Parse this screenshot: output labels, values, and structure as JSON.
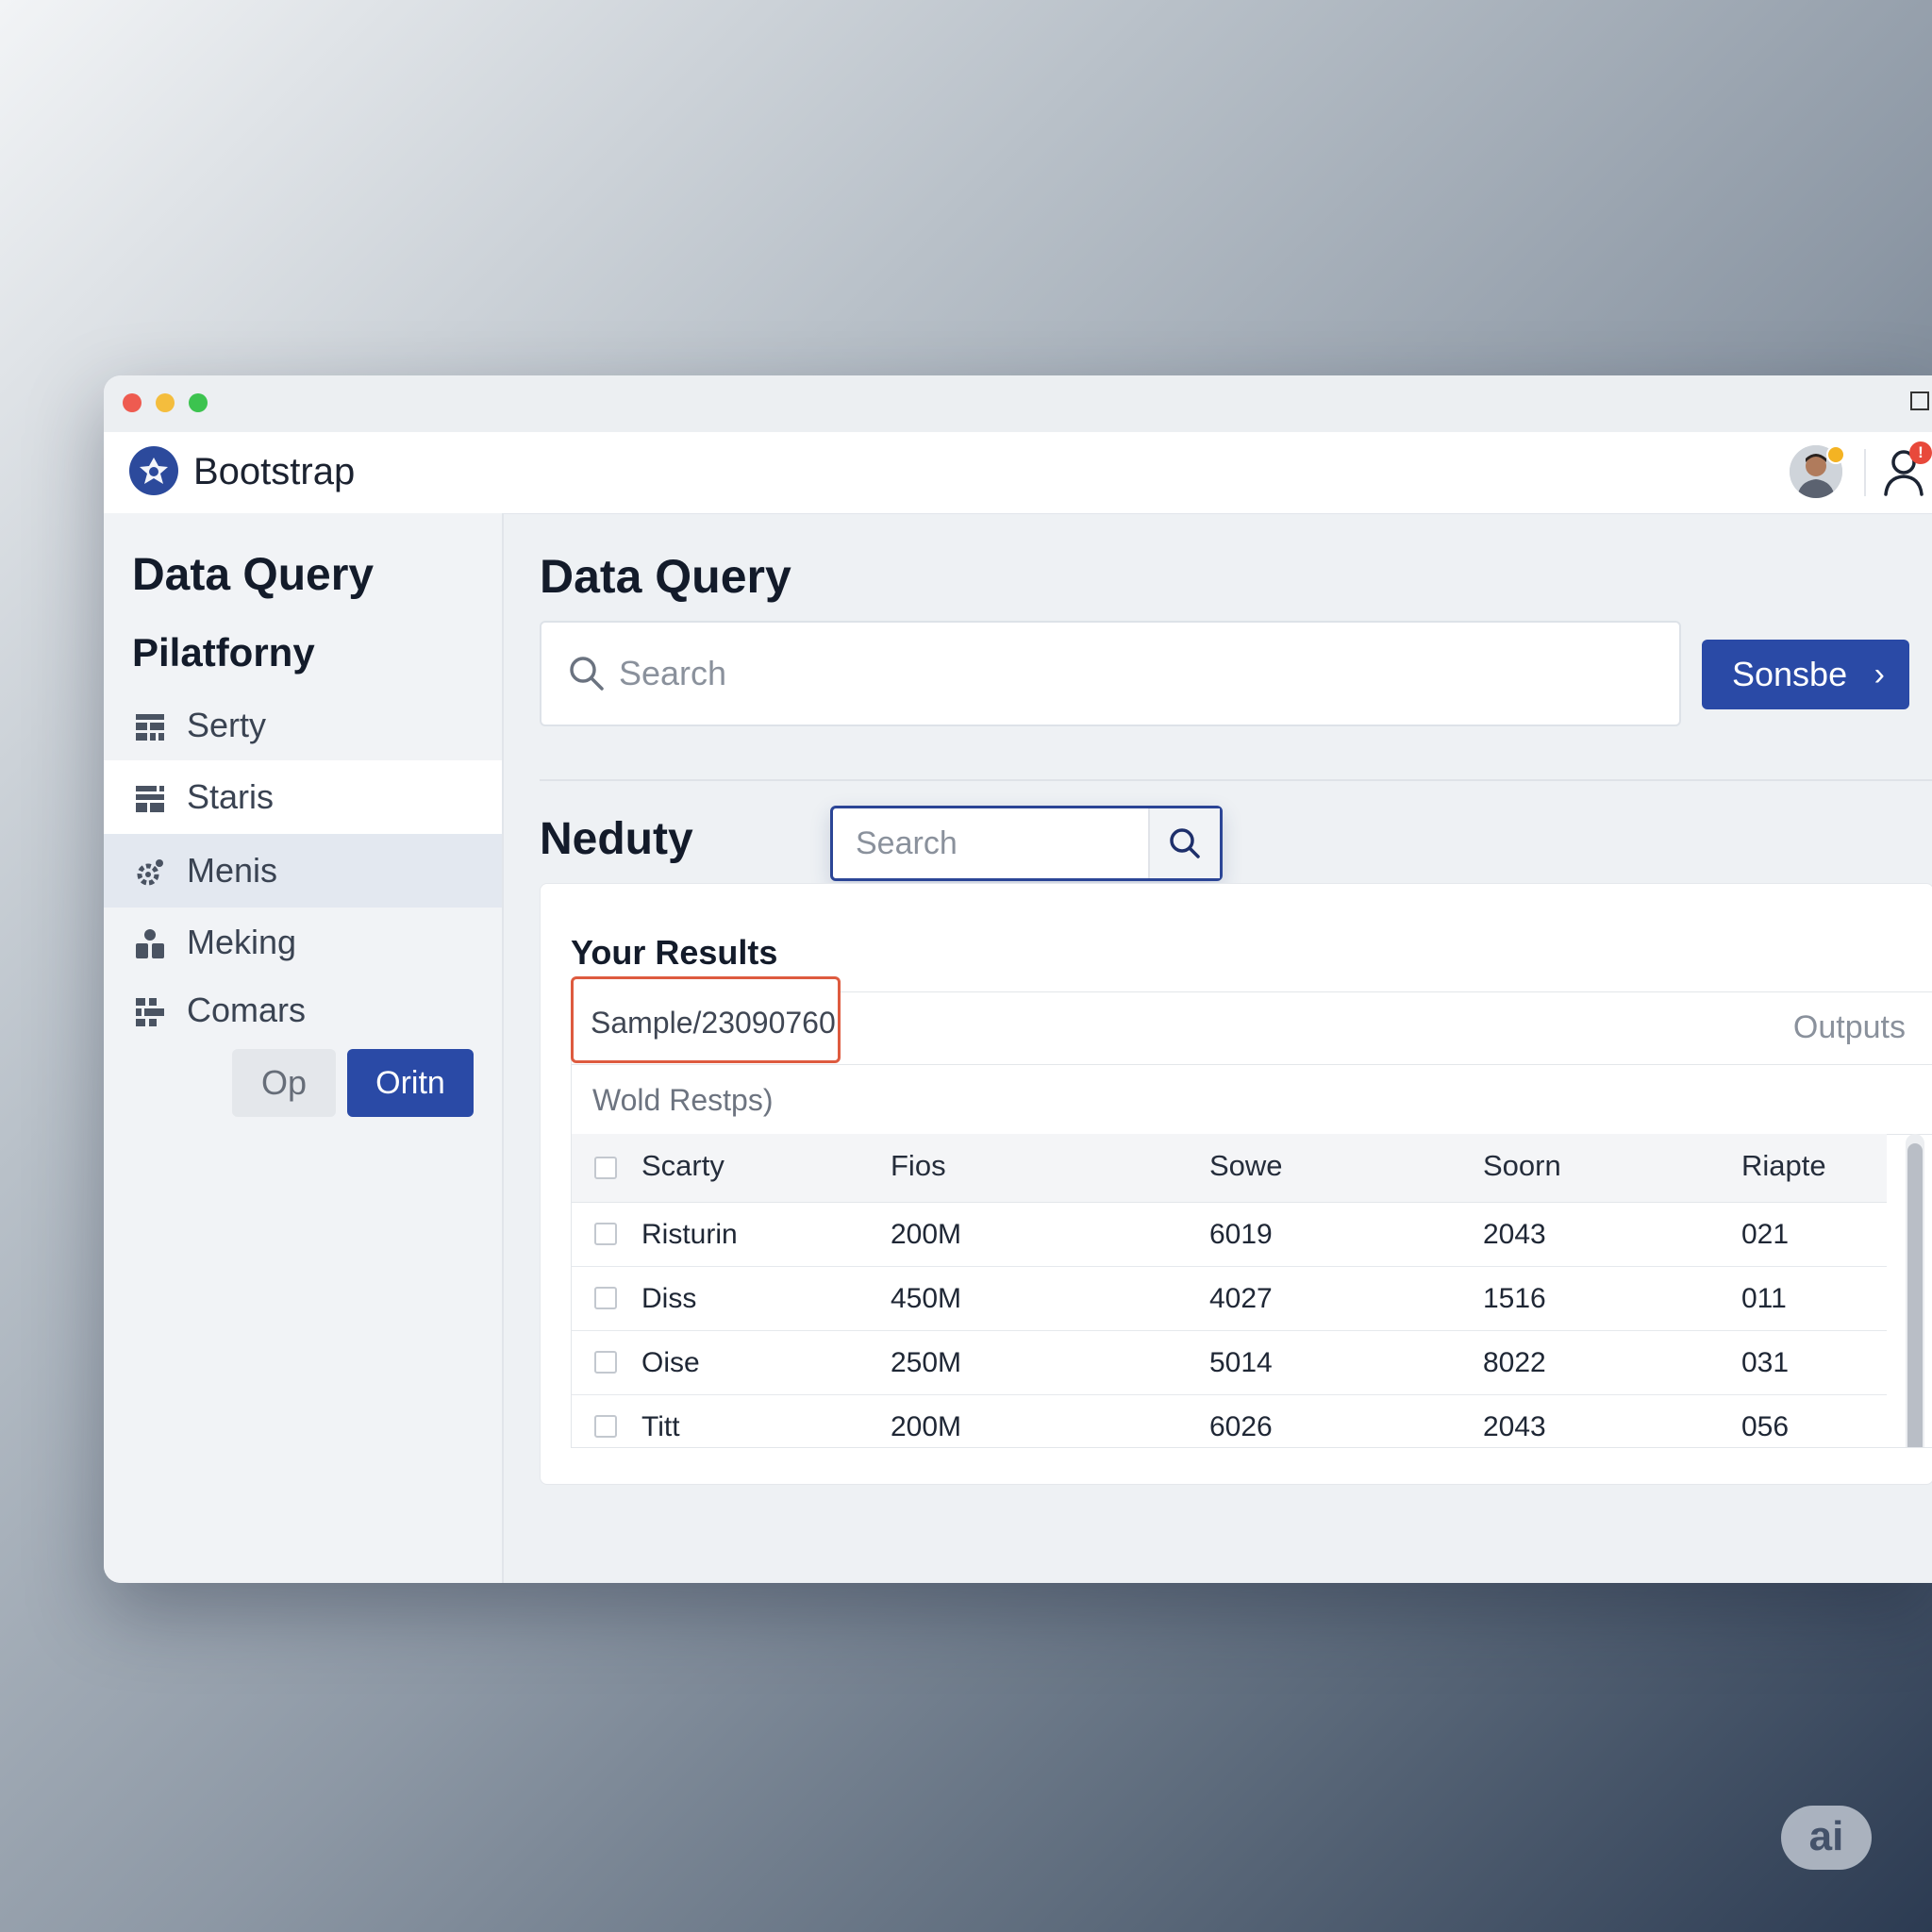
{
  "navbar": {
    "brand": "Bootstrap",
    "notification_count": "!"
  },
  "sidebar": {
    "title": "Data Query",
    "subtitle": "Pilatforny",
    "items": [
      {
        "label": "Serty",
        "icon": "grid-icon"
      },
      {
        "label": "Staris",
        "icon": "table-icon"
      },
      {
        "label": "Menis",
        "icon": "gear-icon"
      },
      {
        "label": "Meking",
        "icon": "users-icon"
      },
      {
        "label": "Comars",
        "icon": "blocks-icon"
      }
    ],
    "buttons": {
      "secondary": "Op",
      "primary": "Oritn"
    }
  },
  "main": {
    "title": "Data Query",
    "search": {
      "placeholder": "Search",
      "submit_label": "Sonsbe",
      "submit_icon": "›"
    },
    "section": {
      "title": "Neduty",
      "search_placeholder": "Search"
    },
    "results": {
      "title": "Your Results",
      "sample_id": "Sample/23090760",
      "outputs_label": "Outputs",
      "subheader": "Wold Restps)",
      "columns": [
        "Scarty",
        "Fios",
        "Sowe",
        "Soorn",
        "Riapte"
      ],
      "rows": [
        [
          "Risturin",
          "200M",
          "6019",
          "2043",
          "021"
        ],
        [
          "Diss",
          "450M",
          "4027",
          "1516",
          "011"
        ],
        [
          "Oise",
          "250M",
          "5014",
          "8022",
          "031"
        ],
        [
          "Titt",
          "200M",
          "6026",
          "2043",
          "056"
        ]
      ]
    }
  },
  "watermark": "ai",
  "colors": {
    "accent": "#2a4aa6",
    "highlight": "#de5b3f",
    "notification": "#e8493b",
    "status": "#f4b323"
  }
}
